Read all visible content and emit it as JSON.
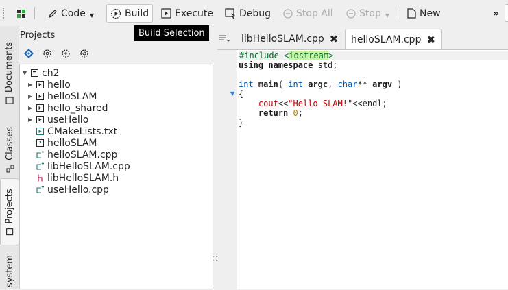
{
  "toolbar": {
    "code_label": "Code",
    "build_label": "Build",
    "execute_label": "Execute",
    "debug_label": "Debug",
    "stop_all_label": "Stop All",
    "stop_label": "Stop",
    "new_label": "New",
    "overflow_glyph": "»"
  },
  "tooltip": {
    "text": "Build Selection"
  },
  "sidebar_tabs": {
    "documents": "Documents",
    "classes": "Classes",
    "projects": "Projects",
    "filesystem": "system"
  },
  "projects_panel": {
    "title": "Projects",
    "tree": [
      {
        "label": "ch2",
        "kind": "project",
        "expanded": true
      },
      {
        "label": "hello",
        "kind": "target",
        "expanded": false
      },
      {
        "label": "helloSLAM",
        "kind": "target",
        "expanded": false
      },
      {
        "label": "hello_shared",
        "kind": "target",
        "expanded": false
      },
      {
        "label": "useHello",
        "kind": "target",
        "expanded": false
      },
      {
        "label": "CMakeLists.txt",
        "kind": "cmake"
      },
      {
        "label": "helloSLAM",
        "kind": "binary"
      },
      {
        "label": "helloSLAM.cpp",
        "kind": "cpp"
      },
      {
        "label": "libHelloSLAM.cpp",
        "kind": "cpp"
      },
      {
        "label": "libHelloSLAM.h",
        "kind": "header"
      },
      {
        "label": "useHello.cpp",
        "kind": "cpp"
      }
    ]
  },
  "editor": {
    "tabs": [
      {
        "label": "libHelloSLAM.cpp",
        "active": false
      },
      {
        "label": "helloSLAM.cpp",
        "active": true
      }
    ],
    "code": {
      "line1_directive": "include <",
      "line1_header": "iostream",
      "line1_close": ">",
      "line2_kw1": "using",
      "line2_kw2": "namespace",
      "line2_rest": " std;",
      "line4_type": "int",
      "line4_fn": "main",
      "line4_a": "( ",
      "line4_t2": "int",
      "line4_p1": "argc",
      "line4_b": ", ",
      "line4_t3": "char",
      "line4_c": "** ",
      "line4_p2": "argv",
      "line4_d": " )",
      "line5": "{",
      "line6_cout": "cout",
      "line6_op": "<<",
      "line6_str": "\"Hello SLAM!\"",
      "line6_end": "<<endl;",
      "line7_kw": "return",
      "line7_num": "0",
      "line7_semi": ";",
      "line8": "}"
    }
  },
  "colors": {
    "tooltip_bg": "#000000",
    "keyword_type": "#0057ae",
    "string": "#bf0303",
    "number": "#b08000",
    "preprocessor": "#006e28"
  }
}
